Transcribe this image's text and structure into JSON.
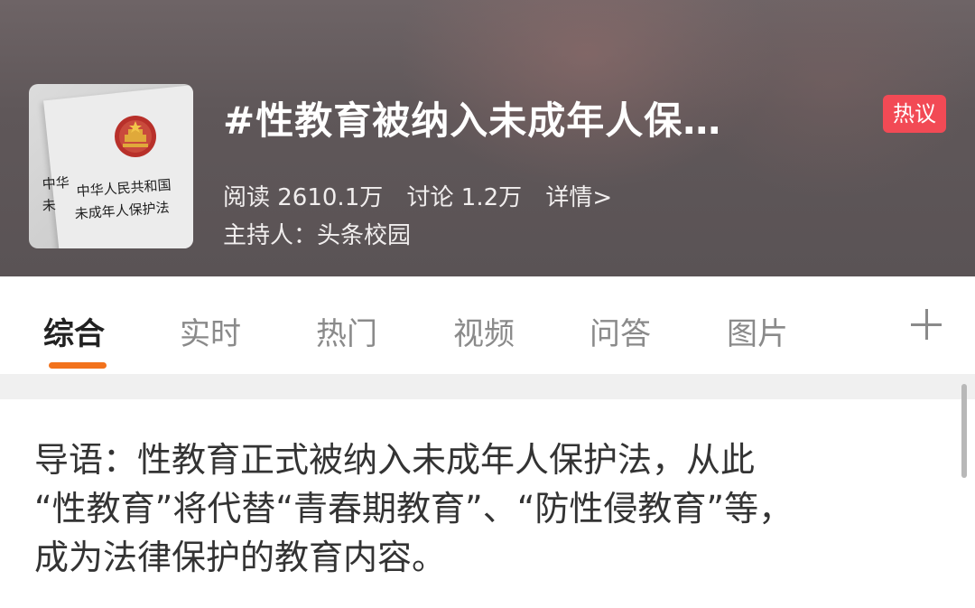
{
  "topic": {
    "cover_lines": [
      "中华",
      "中华人民共和国",
      "未",
      "未成年人保护法"
    ],
    "title": "#性教育被纳入未成年人保…",
    "badge": "热议",
    "reads": "阅读 2610.1万",
    "discussions": "讨论 1.2万",
    "details_link": "详情>",
    "host": "主持人：头条校园"
  },
  "tabs": [
    {
      "label": "综合",
      "active": true
    },
    {
      "label": "实时",
      "active": false
    },
    {
      "label": "热门",
      "active": false
    },
    {
      "label": "视频",
      "active": false
    },
    {
      "label": "问答",
      "active": false
    },
    {
      "label": "图片",
      "active": false
    }
  ],
  "add_tab_icon": "plus-icon",
  "lead_text": [
    "导语：性教育正式被纳入未成年人保护法，从此",
    "“性教育”将代替“青春期教育”、“防性侵教育”等，",
    "成为法律保护的教育内容。"
  ],
  "colors": {
    "accent": "#f2721c",
    "badge": "#f24a55",
    "header_bg": "#5f5759"
  }
}
